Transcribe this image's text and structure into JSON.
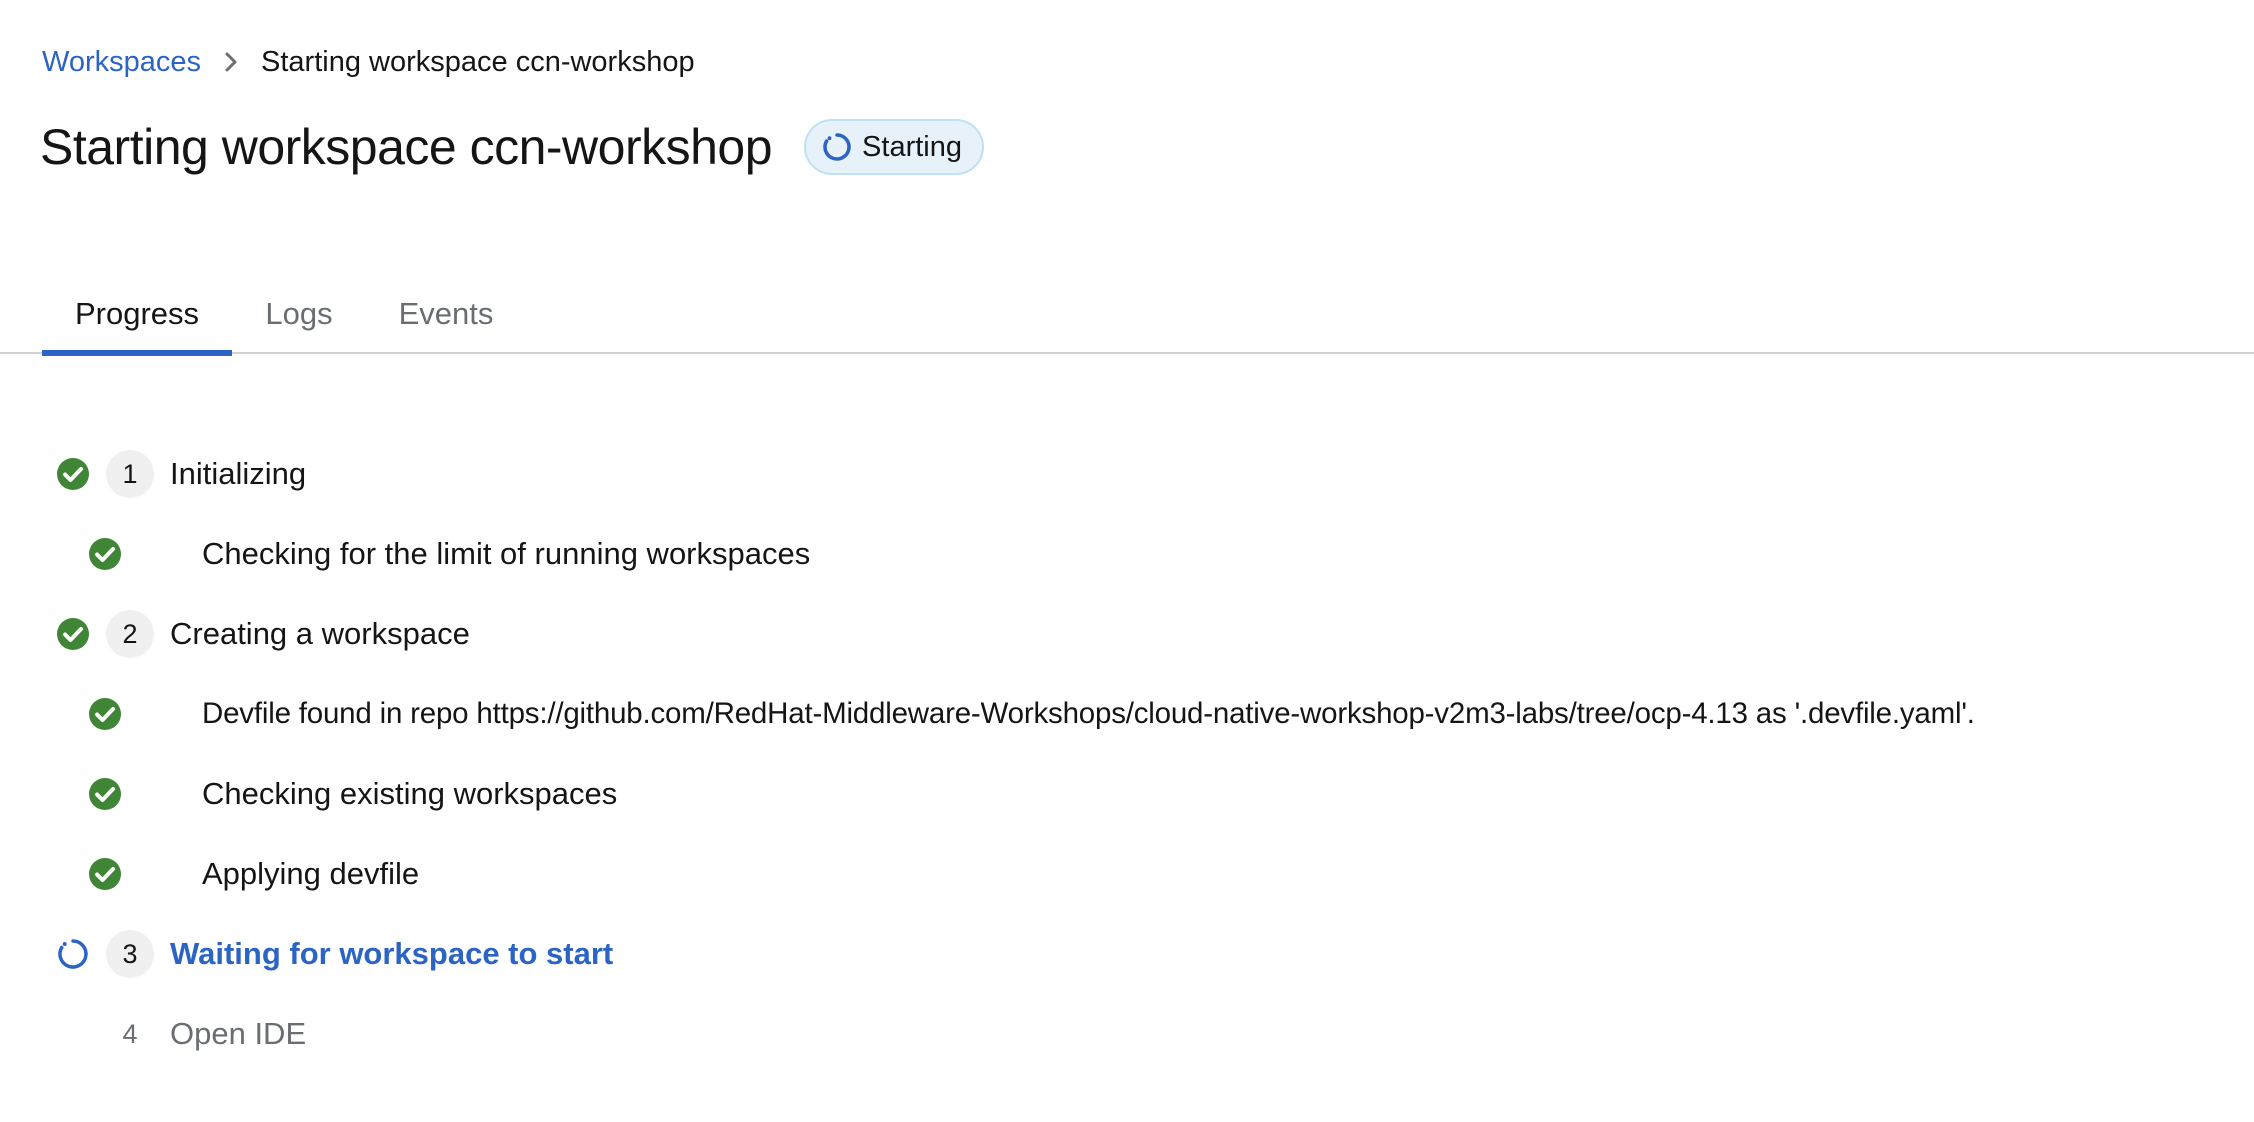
{
  "breadcrumb": {
    "root": "Workspaces",
    "current": "Starting workspace ccn-workshop"
  },
  "header": {
    "title": "Starting workspace ccn-workshop",
    "status": "Starting"
  },
  "tabs": [
    {
      "label": "Progress",
      "active": true
    },
    {
      "label": "Logs",
      "active": false
    },
    {
      "label": "Events",
      "active": false
    }
  ],
  "steps": [
    {
      "number": "1",
      "label": "Initializing",
      "state": "done"
    },
    {
      "label": "Checking for the limit of running workspaces",
      "state": "done",
      "sub": true
    },
    {
      "number": "2",
      "label": "Creating a workspace",
      "state": "done"
    },
    {
      "label": "Devfile found in repo https://github.com/RedHat-Middleware-Workshops/cloud-native-workshop-v2m3-labs/tree/ocp-4.13 as '.devfile.yaml'.",
      "state": "done",
      "sub": true
    },
    {
      "label": "Checking existing workspaces",
      "state": "done",
      "sub": true
    },
    {
      "label": "Applying devfile",
      "state": "done",
      "sub": true
    },
    {
      "number": "3",
      "label": "Waiting for workspace to start",
      "state": "in-progress"
    },
    {
      "number": "4",
      "label": "Open IDE",
      "state": "pending"
    }
  ],
  "colors": {
    "success": "#3e8635",
    "link": "#2b64c4",
    "badge_bg": "#e7f1fa"
  }
}
